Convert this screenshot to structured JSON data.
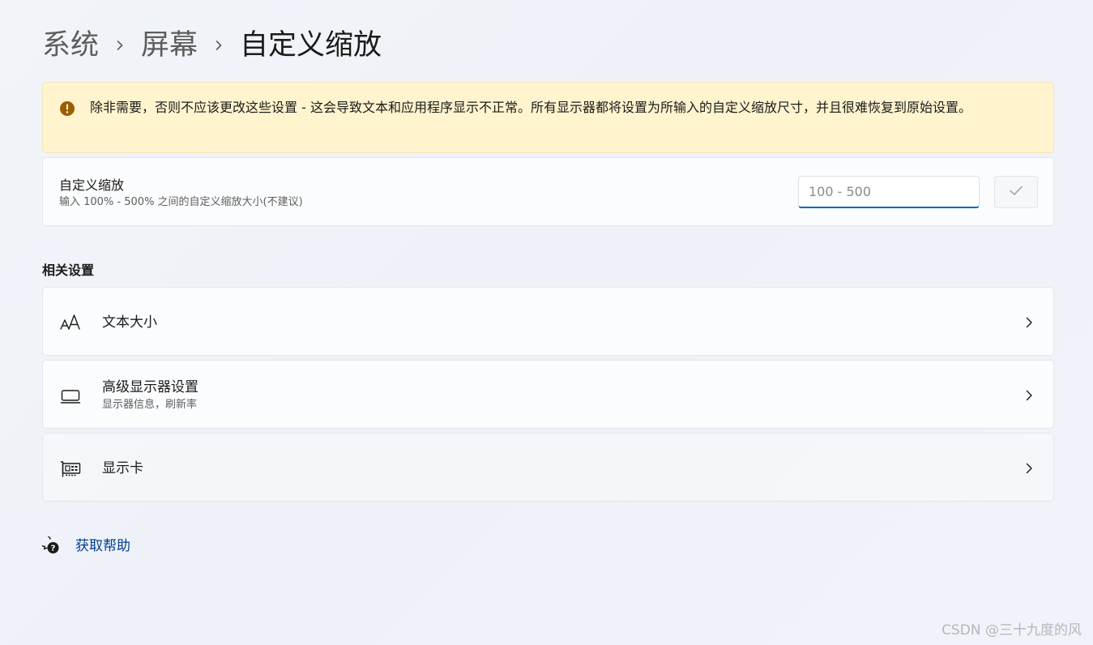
{
  "breadcrumb": {
    "items": [
      "系统",
      "屏幕",
      "自定义缩放"
    ]
  },
  "warning": {
    "text": "除非需要，否则不应该更改这些设置 - 这会导致文本和应用程序显示不正常。所有显示器都将设置为所输入的自定义缩放尺寸，并且很难恢复到原始设置。",
    "icon": "warning-circle-icon",
    "color": "#fff4ce"
  },
  "custom_scaling": {
    "title": "自定义缩放",
    "subtitle": "输入 100% - 500% 之间的自定义缩放大小(不建议)",
    "input_placeholder": "100 - 500",
    "input_value": "",
    "apply_icon": "checkmark-icon"
  },
  "related": {
    "header": "相关设置",
    "items": [
      {
        "label": "文本大小",
        "subtitle": "",
        "icon": "text-size-icon"
      },
      {
        "label": "高级显示器设置",
        "subtitle": "显示器信息，刷新率",
        "icon": "monitor-icon"
      },
      {
        "label": "显示卡",
        "subtitle": "",
        "icon": "graphics-card-icon"
      }
    ]
  },
  "help": {
    "label": "获取帮助",
    "icon": "help-chat-icon"
  },
  "watermark": "CSDN @三十九度的风",
  "colors": {
    "accent": "#0067c0",
    "link": "#003e92",
    "warning_bg": "#fff4ce",
    "warning_icon": "#9d5d00"
  }
}
